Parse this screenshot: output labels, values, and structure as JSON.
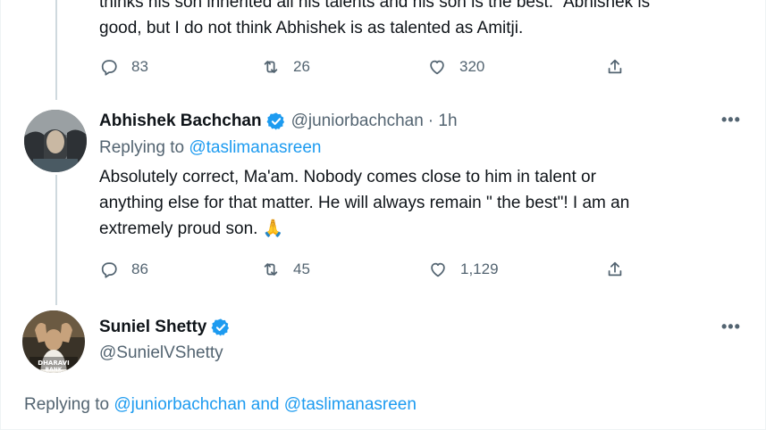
{
  "tweet1": {
    "text_line1": "thinks his son inherited all his talents and his son is the best.\" Abhishek is",
    "text_line2": "good, but I do not think Abhishek is as talented as Amitji.",
    "replies": "83",
    "retweets": "26",
    "likes": "320"
  },
  "tweet2": {
    "name": "Abhishek Bachchan",
    "handle": "@juniorbachchan",
    "time": "· 1h",
    "replying_label": "Replying to ",
    "replying_to": "@taslimanasreen",
    "text_line1": "Absolutely correct, Ma'am. Nobody comes close to him in talent or",
    "text_line2": "anything else for that matter. He will always remain \" the best\"! I am an",
    "text_line3": "extremely proud son. 🙏",
    "replies": "86",
    "retweets": "45",
    "likes": "1,129"
  },
  "tweet3": {
    "name": "Suniel Shetty",
    "handle": "@SunielVShetty",
    "replying_label": "Replying to ",
    "replying_to_1": "@juniorbachchan",
    "and": " and ",
    "replying_to_2": "@taslimanasreen"
  },
  "icons": {
    "reply": "reply-icon",
    "retweet": "retweet-icon",
    "like": "like-icon",
    "share": "share-icon",
    "verified": "verified-badge-icon",
    "more": "more-icon"
  },
  "colors": {
    "accent": "#1d9bf0",
    "secondary_text": "#536471",
    "primary_text": "#0f1419"
  }
}
